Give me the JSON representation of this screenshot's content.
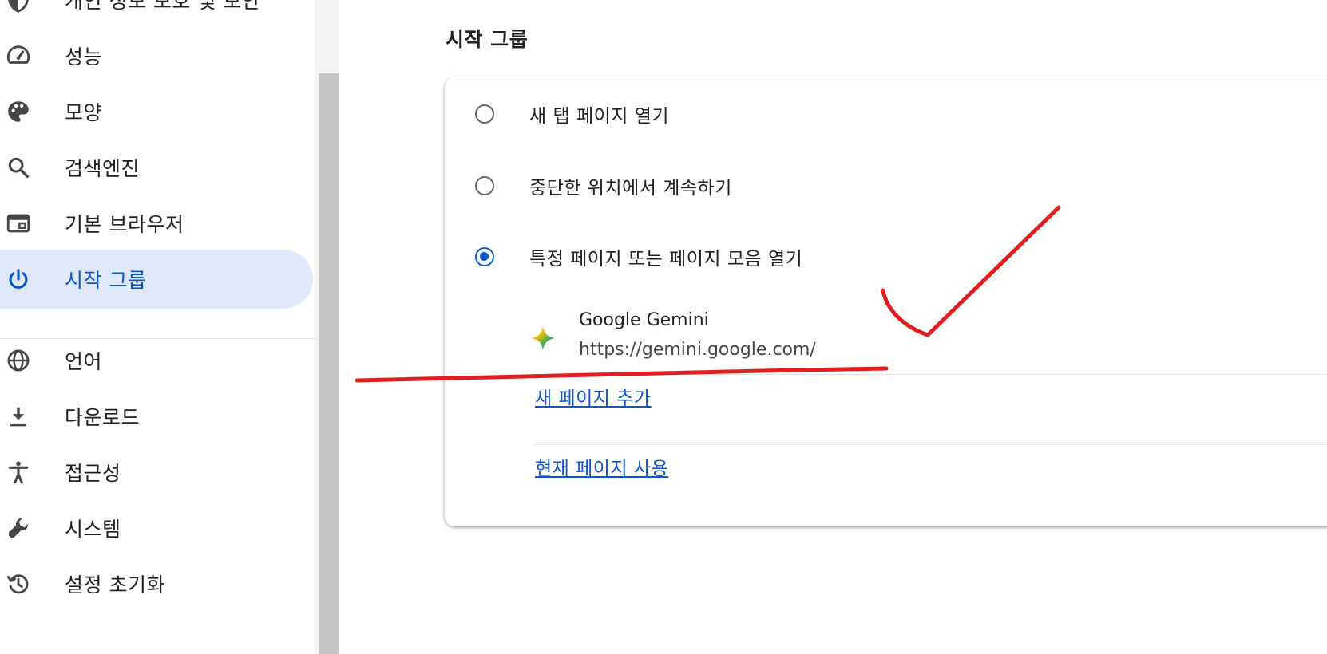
{
  "sidebar": {
    "items": [
      {
        "label": "개인 정보 보호 및 보안",
        "icon": "shield-icon"
      },
      {
        "label": "성능",
        "icon": "speedometer-icon"
      },
      {
        "label": "모양",
        "icon": "palette-icon"
      },
      {
        "label": "검색엔진",
        "icon": "search-icon"
      },
      {
        "label": "기본 브라우저",
        "icon": "browser-window-icon"
      },
      {
        "label": "시작 그룹",
        "icon": "power-icon",
        "active": true
      },
      {
        "label": "언어",
        "icon": "globe-icon"
      },
      {
        "label": "다운로드",
        "icon": "download-icon"
      },
      {
        "label": "접근성",
        "icon": "accessibility-icon"
      },
      {
        "label": "시스템",
        "icon": "wrench-icon"
      },
      {
        "label": "설정 초기화",
        "icon": "history-icon"
      }
    ]
  },
  "main": {
    "section_title": "시작 그룹",
    "options": [
      {
        "label": "새 탭 페이지 열기",
        "checked": false
      },
      {
        "label": "중단한 위치에서 계속하기",
        "checked": false
      },
      {
        "label": "특정 페이지 또는 페이지 모음 열기",
        "checked": true
      }
    ],
    "page": {
      "name": "Google Gemini",
      "url": "https://gemini.google.com/",
      "icon": "gemini-sparkle-icon"
    },
    "links": {
      "add_page": "새 페이지 추가",
      "use_current": "현재 페이지 사용"
    }
  },
  "colors": {
    "accent": "#0b57d0",
    "active_bg": "#dfe9fb",
    "annotation": "#e02020"
  }
}
